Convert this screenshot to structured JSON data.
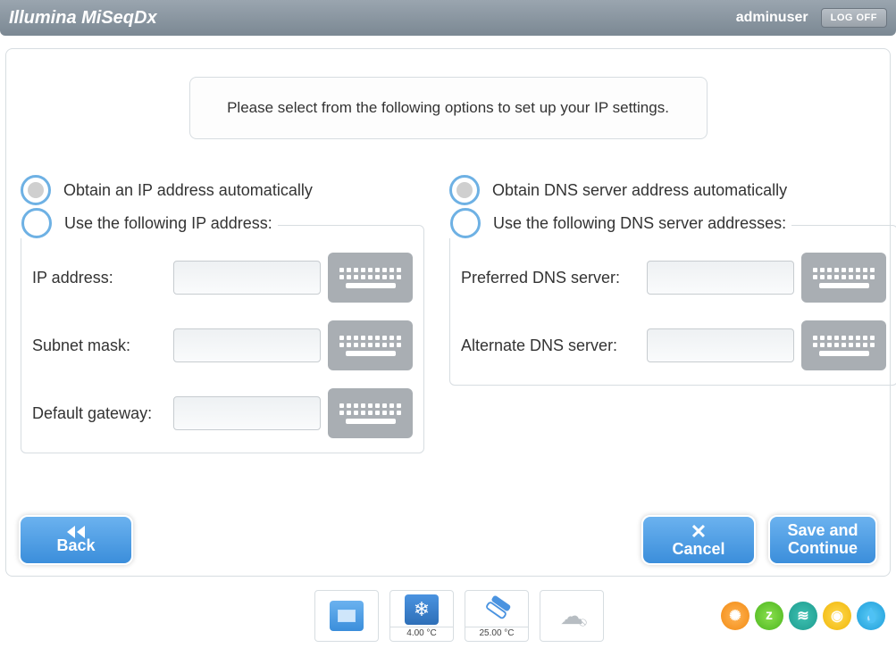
{
  "header": {
    "title": "Illumina MiSeqDx",
    "user": "adminuser",
    "logoff": "LOG OFF"
  },
  "instruction": "Please select from the following options to set up your IP settings.",
  "ip": {
    "auto_label": "Obtain an IP address automatically",
    "manual_label": "Use the following IP address:",
    "addr_label": "IP address:",
    "addr_value": "",
    "mask_label": "Subnet mask:",
    "mask_value": "",
    "gateway_label": "Default gateway:",
    "gateway_value": ""
  },
  "dns": {
    "auto_label": "Obtain DNS server address automatically",
    "manual_label": "Use the following DNS server addresses:",
    "preferred_label": "Preferred DNS server:",
    "preferred_value": "",
    "alternate_label": "Alternate DNS server:",
    "alternate_value": ""
  },
  "footer": {
    "back": "Back",
    "cancel": "Cancel",
    "save": "Save and Continue"
  },
  "status": {
    "temp1": "4.00 °C",
    "temp2": "25.00 °C"
  }
}
